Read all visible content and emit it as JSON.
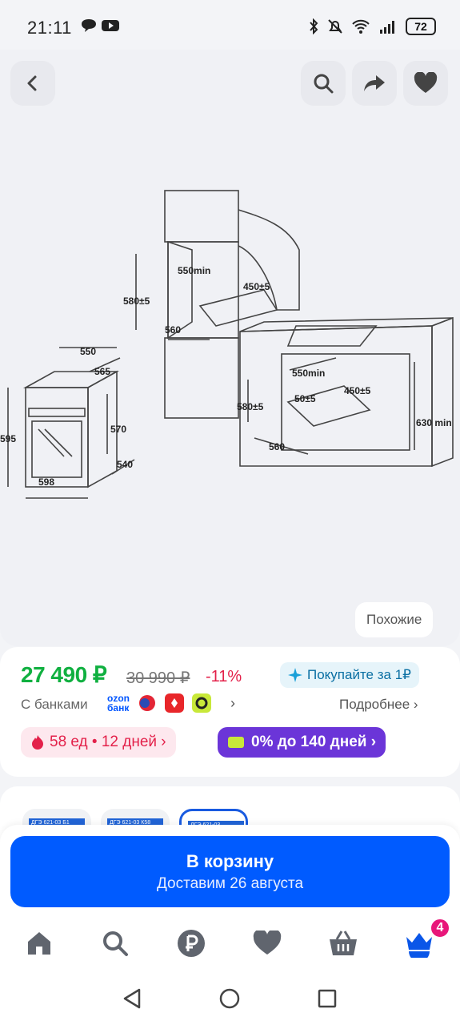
{
  "status": {
    "time": "21:11",
    "battery": "72"
  },
  "image": {
    "similar_label": "Похожие",
    "dims": {
      "d1": "550",
      "d2": "565",
      "d3": "570",
      "d4": "598",
      "d5": "595",
      "d6": "540",
      "d7": "550min",
      "d8": "450±5",
      "d9": "580±5",
      "d10": "560",
      "d11": "550min",
      "d12": "50±5",
      "d13": "450±5",
      "d14": "580±5",
      "d15": "560",
      "d16": "630 min"
    }
  },
  "price": {
    "current": "27 490 ₽",
    "old": "30 990 ₽",
    "discount": "-11%",
    "buy_for_1": "Покупайте за 1₽",
    "banks_label": "С банками",
    "ozon_top": "ozon",
    "ozon_bottom": "банк",
    "banks_more": "›",
    "details": "Подробнее ›",
    "stock": "58 ед • 12 дней ›",
    "installment": "0% до 140 дней ›"
  },
  "variants": [
    "ДГЭ 621-03 Б1",
    "ДГЭ 621-03 К58",
    "ДГЭ 621-03"
  ],
  "cart": {
    "title": "В корзину",
    "subtitle": "Доставим 26 августа"
  },
  "tabbar": {
    "badge": "4"
  },
  "colors": {
    "accent": "#005bff",
    "price_green": "#10b040",
    "discount_red": "#e3214a",
    "installment_purple": "#6b35d8",
    "badge_pink": "#e8177a"
  }
}
